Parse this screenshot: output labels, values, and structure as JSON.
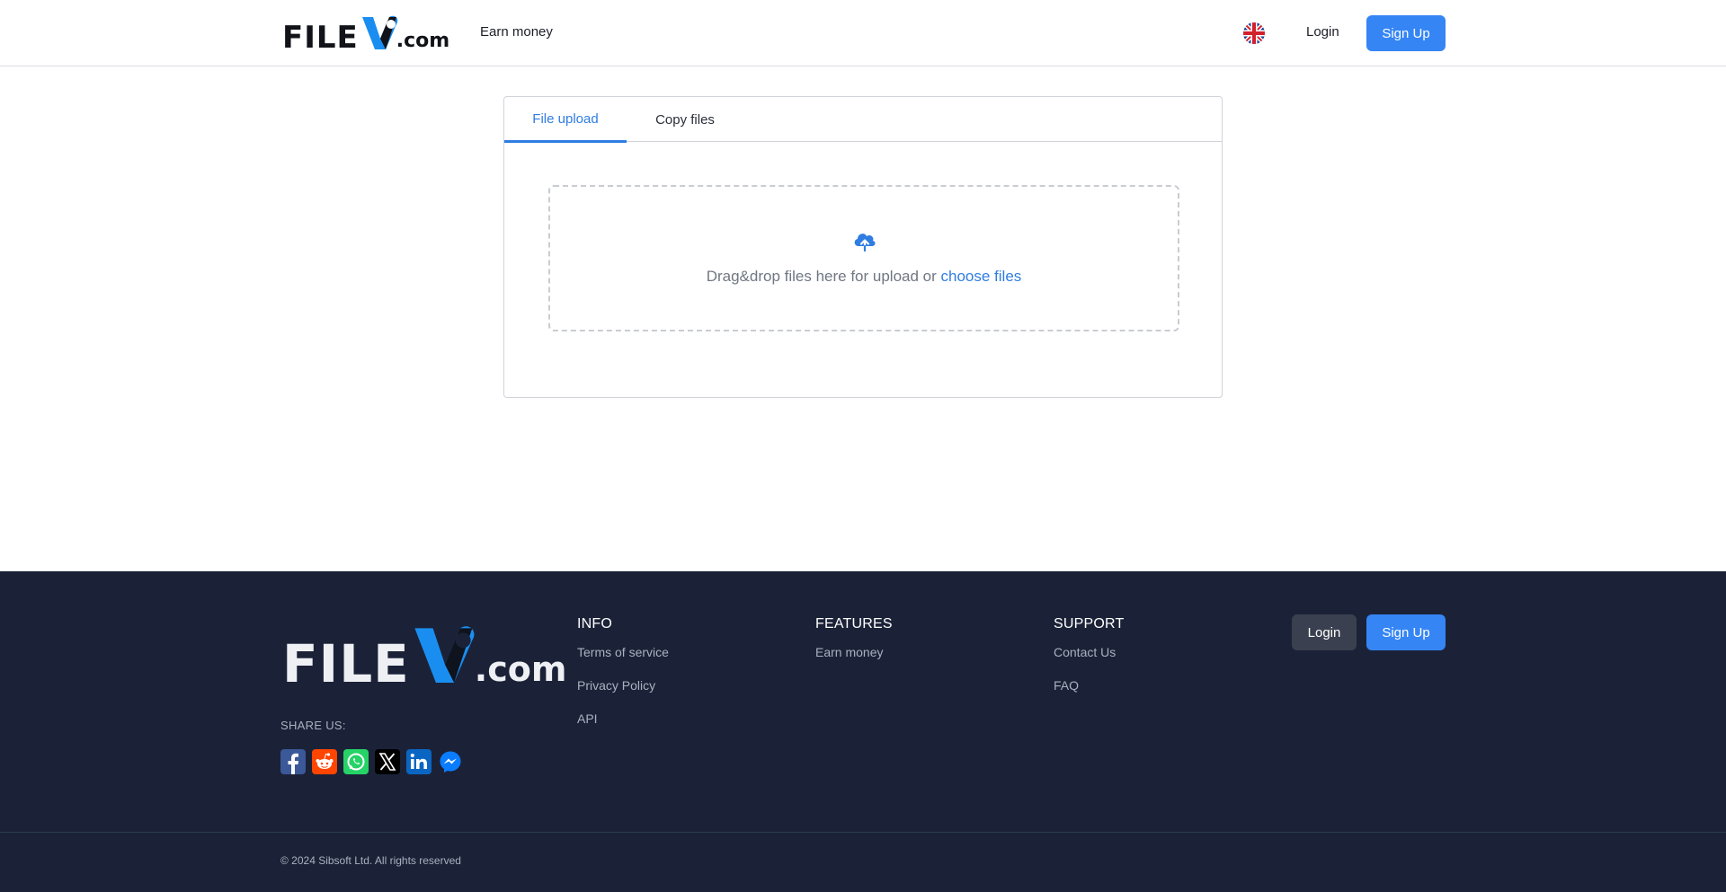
{
  "colors": {
    "accent": "#3585f5",
    "link": "#2f7de1",
    "footer_bg": "#1b2238"
  },
  "header": {
    "logo": {
      "file_text": "FILE",
      "v_text": "V",
      "dotcom_text": ".com"
    },
    "nav_earn": "Earn money",
    "language_icon": "uk-flag-icon",
    "login": "Login",
    "signup": "Sign Up"
  },
  "upload": {
    "tabs": [
      {
        "label": "File upload",
        "active": true
      },
      {
        "label": "Copy files",
        "active": false
      }
    ],
    "dropzone": {
      "icon": "cloud-upload-icon",
      "text": "Drag&drop files here for upload or",
      "link": "choose files"
    }
  },
  "footer": {
    "logo": {
      "file_text": "FILE",
      "v_text": "V",
      "dotcom_text": ".com"
    },
    "share_label": "SHARE US:",
    "socials": [
      {
        "name": "facebook-icon"
      },
      {
        "name": "reddit-icon"
      },
      {
        "name": "whatsapp-icon"
      },
      {
        "name": "x-icon"
      },
      {
        "name": "linkedin-icon"
      },
      {
        "name": "messenger-icon"
      }
    ],
    "info": {
      "title": "INFO",
      "links": [
        "Terms of service",
        "Privacy Policy",
        "API"
      ]
    },
    "features": {
      "title": "FEATURES",
      "links": [
        "Earn money"
      ]
    },
    "support": {
      "title": "SUPPORT",
      "links": [
        "Contact Us",
        "FAQ"
      ]
    },
    "login": "Login",
    "signup": "Sign Up",
    "copyright": "© 2024 Sibsoft Ltd. All rights reserved"
  }
}
